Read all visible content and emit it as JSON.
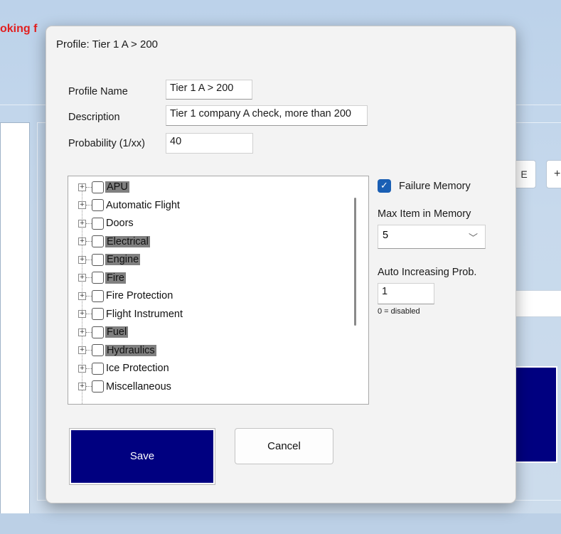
{
  "background": {
    "header_text": "oking f",
    "button1_label": "E",
    "button2_label": "+"
  },
  "dialog": {
    "title": "Profile: Tier 1 A > 200",
    "profile_name_label": "Profile Name",
    "profile_name_value": "Tier 1 A > 200",
    "description_label": "Description",
    "description_value": "Tier 1 company A check, more than 200",
    "probability_label": "Probability (1/xx)",
    "probability_value": "40"
  },
  "tree": {
    "items": [
      {
        "label": "APU",
        "selected": true
      },
      {
        "label": "Automatic Flight",
        "selected": false
      },
      {
        "label": "Doors",
        "selected": false
      },
      {
        "label": "Electrical",
        "selected": true
      },
      {
        "label": "Engine",
        "selected": true
      },
      {
        "label": "Fire",
        "selected": true
      },
      {
        "label": "Fire Protection",
        "selected": false
      },
      {
        "label": "Flight Instrument",
        "selected": false
      },
      {
        "label": "Fuel",
        "selected": true
      },
      {
        "label": "Hydraulics",
        "selected": true
      },
      {
        "label": "Ice Protection",
        "selected": false
      },
      {
        "label": "Miscellaneous",
        "selected": false
      }
    ]
  },
  "options": {
    "failure_memory_label": "Failure Memory",
    "failure_memory_checked": true,
    "max_item_label": "Max Item in Memory",
    "max_item_value": "5",
    "auto_increasing_label": "Auto Increasing Prob.",
    "auto_increasing_value": "1",
    "auto_increasing_hint": "0 = disabled"
  },
  "buttons": {
    "save_label": "Save",
    "cancel_label": "Cancel"
  },
  "colors": {
    "save_bg": "#000080",
    "highlight": "#808080",
    "checkbox_accent": "#1a5fb4"
  }
}
